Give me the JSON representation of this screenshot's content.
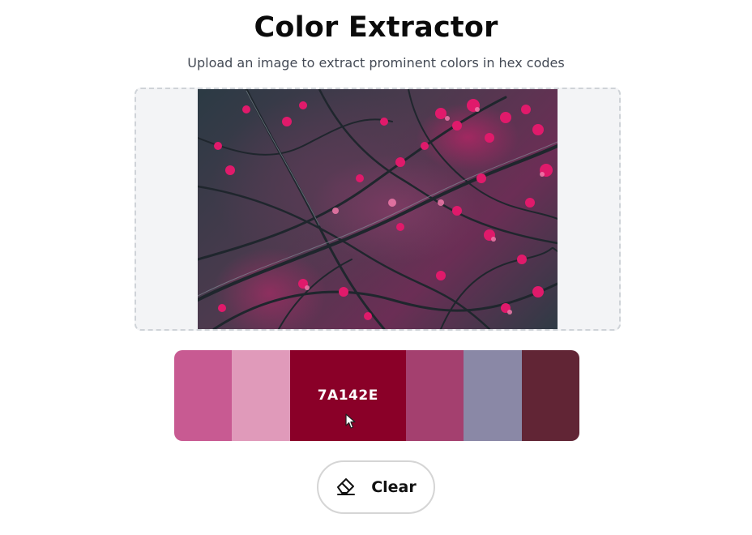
{
  "header": {
    "title": "Color Extractor",
    "subtitle": "Upload an image to extract prominent colors in hex codes"
  },
  "upload": {
    "image_alt": "Pink blossoms on dark branches"
  },
  "palette": {
    "swatches": [
      {
        "color": "#C85A92",
        "hex": ""
      },
      {
        "color": "#E09ABA",
        "hex": ""
      },
      {
        "color": "#8A0028",
        "hex": "7A142E",
        "flex": 2
      },
      {
        "color": "#A4406F",
        "hex": ""
      },
      {
        "color": "#8A88A6",
        "hex": ""
      },
      {
        "color": "#612535",
        "hex": ""
      }
    ]
  },
  "actions": {
    "clear_label": "Clear",
    "clear_icon": "eraser-icon"
  }
}
